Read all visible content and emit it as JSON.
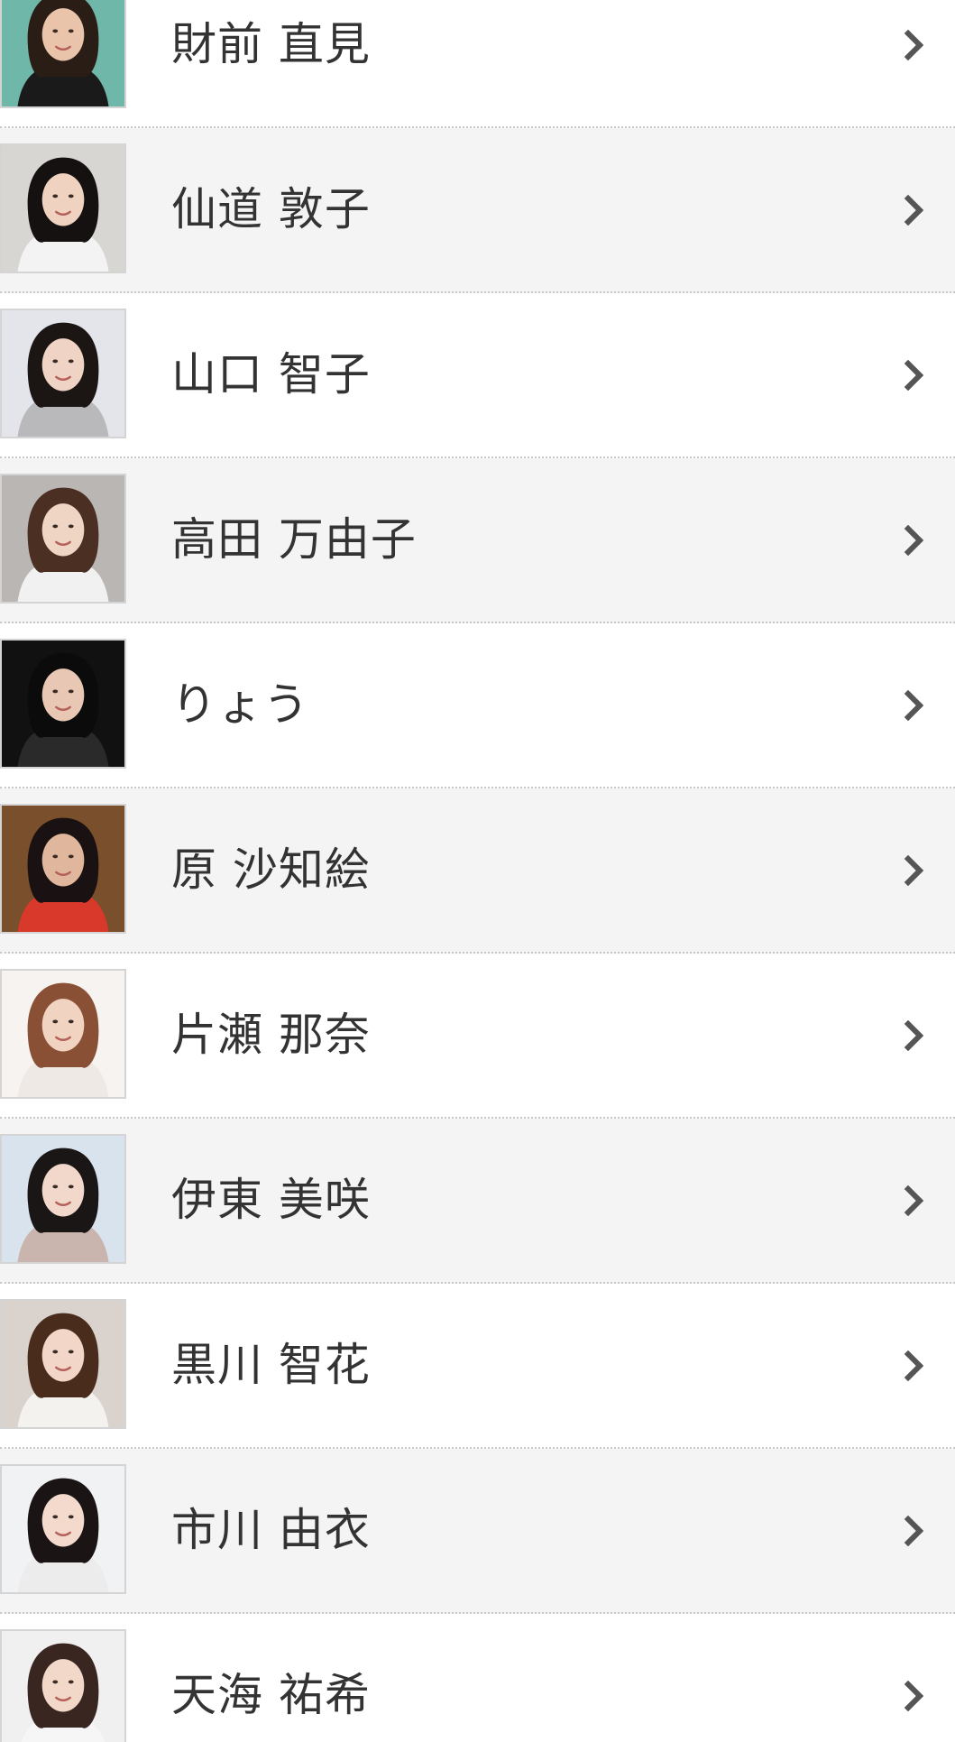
{
  "people": [
    {
      "name": "財前 直見",
      "photo": {
        "bg": "#6fb8a9",
        "hair": "#2a1d16",
        "skin": "#e9c4aa",
        "top": "#1a1a1a"
      }
    },
    {
      "name": "仙道 敦子",
      "photo": {
        "bg": "#d8d6d2",
        "hair": "#141110",
        "skin": "#efd2bf",
        "top": "#f3f3f3"
      }
    },
    {
      "name": "山口 智子",
      "photo": {
        "bg": "#e3e5ea",
        "hair": "#1b1514",
        "skin": "#efd4c5",
        "top": "#b9b9bb"
      }
    },
    {
      "name": "高田 万由子",
      "photo": {
        "bg": "#b9b6b4",
        "hair": "#4a2f22",
        "skin": "#efd5c4",
        "top": "#f1f1f1"
      }
    },
    {
      "name": "りょう",
      "photo": {
        "bg": "#111111",
        "hair": "#0b0b0b",
        "skin": "#e8c8b5",
        "top": "#2a2a2a"
      }
    },
    {
      "name": "原 沙知絵",
      "photo": {
        "bg": "#7a4f2c",
        "hair": "#1a1212",
        "skin": "#e0b79c",
        "top": "#d8392a"
      }
    },
    {
      "name": "片瀬 那奈",
      "photo": {
        "bg": "#f7f3f0",
        "hair": "#8a5036",
        "skin": "#f1d3c2",
        "top": "#efe9e6"
      }
    },
    {
      "name": "伊東 美咲",
      "photo": {
        "bg": "#d9e3ee",
        "hair": "#1b1616",
        "skin": "#f2d8cb",
        "top": "#c9b4ae"
      }
    },
    {
      "name": "黒川 智花",
      "photo": {
        "bg": "#d9d2cd",
        "hair": "#4a2c1d",
        "skin": "#f2d6c7",
        "top": "#f4f2ef"
      }
    },
    {
      "name": "市川 由衣",
      "photo": {
        "bg": "#f1f2f4",
        "hair": "#1a1414",
        "skin": "#f3dacd",
        "top": "#ececec"
      }
    },
    {
      "name": "天海 祐希",
      "photo": {
        "bg": "#f0f0f0",
        "hair": "#3a2620",
        "skin": "#f2d8c9",
        "top": "#f6f6f6"
      }
    }
  ],
  "colors": {
    "row_alt": "#f4f4f4",
    "row": "#ffffff",
    "text": "#333333",
    "chevron": "#555555",
    "divider": "#c8c8c8"
  },
  "icons": {
    "row_chevron": "chevron-right-icon",
    "photo": "portrait-photo"
  }
}
